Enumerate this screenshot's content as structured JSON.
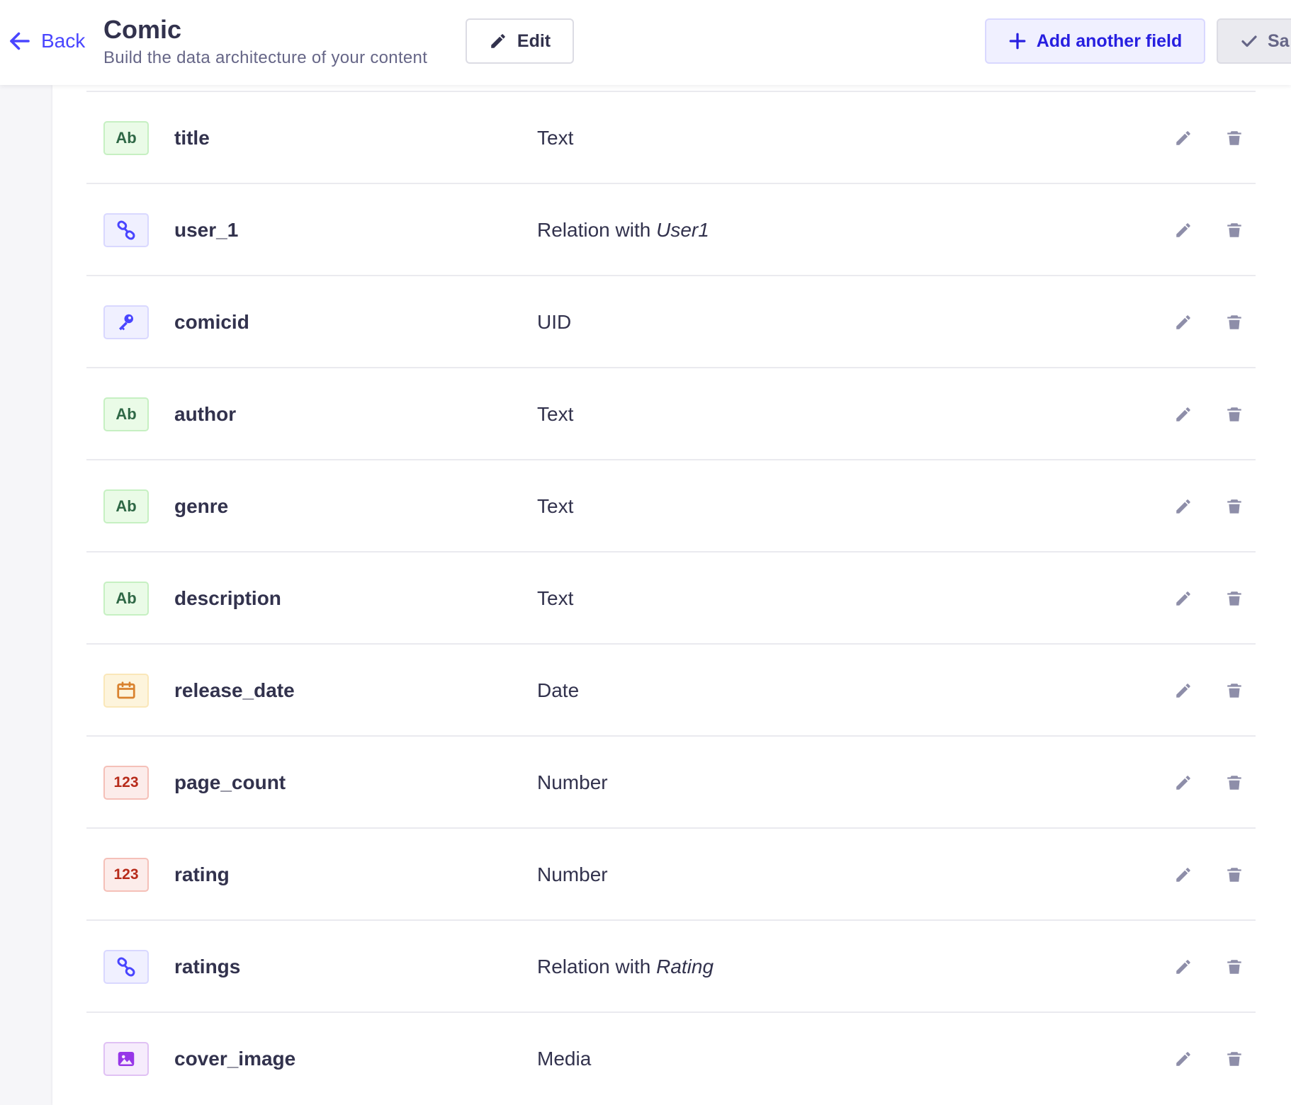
{
  "header": {
    "back_label": "Back",
    "title": "Comic",
    "subtitle": "Build the data architecture of your content",
    "edit_label": "Edit",
    "add_field_label": "Add another field",
    "save_label": "Sa"
  },
  "colors": {
    "primary": "#4945ff",
    "text": "#32324d",
    "muted": "#666687",
    "action_icon": "#8e8ea9"
  },
  "fields": [
    {
      "name": "title",
      "type_label": "Text",
      "target": "",
      "icon": "text-icon",
      "icon_text": "Ab"
    },
    {
      "name": "user_1",
      "type_label": "Relation with ",
      "target": "User1",
      "icon": "relation-icon",
      "icon_text": ""
    },
    {
      "name": "comicid",
      "type_label": "UID",
      "target": "",
      "icon": "uid-key-icon",
      "icon_text": ""
    },
    {
      "name": "author",
      "type_label": "Text",
      "target": "",
      "icon": "text-icon",
      "icon_text": "Ab"
    },
    {
      "name": "genre",
      "type_label": "Text",
      "target": "",
      "icon": "text-icon",
      "icon_text": "Ab"
    },
    {
      "name": "description",
      "type_label": "Text",
      "target": "",
      "icon": "text-icon",
      "icon_text": "Ab"
    },
    {
      "name": "release_date",
      "type_label": "Date",
      "target": "",
      "icon": "calendar-icon",
      "icon_text": ""
    },
    {
      "name": "page_count",
      "type_label": "Number",
      "target": "",
      "icon": "number-icon",
      "icon_text": "123"
    },
    {
      "name": "rating",
      "type_label": "Number",
      "target": "",
      "icon": "number-icon",
      "icon_text": "123"
    },
    {
      "name": "ratings",
      "type_label": "Relation with ",
      "target": "Rating",
      "icon": "relation-icon",
      "icon_text": ""
    },
    {
      "name": "cover_image",
      "type_label": "Media",
      "target": "",
      "icon": "media-icon",
      "icon_text": ""
    }
  ]
}
